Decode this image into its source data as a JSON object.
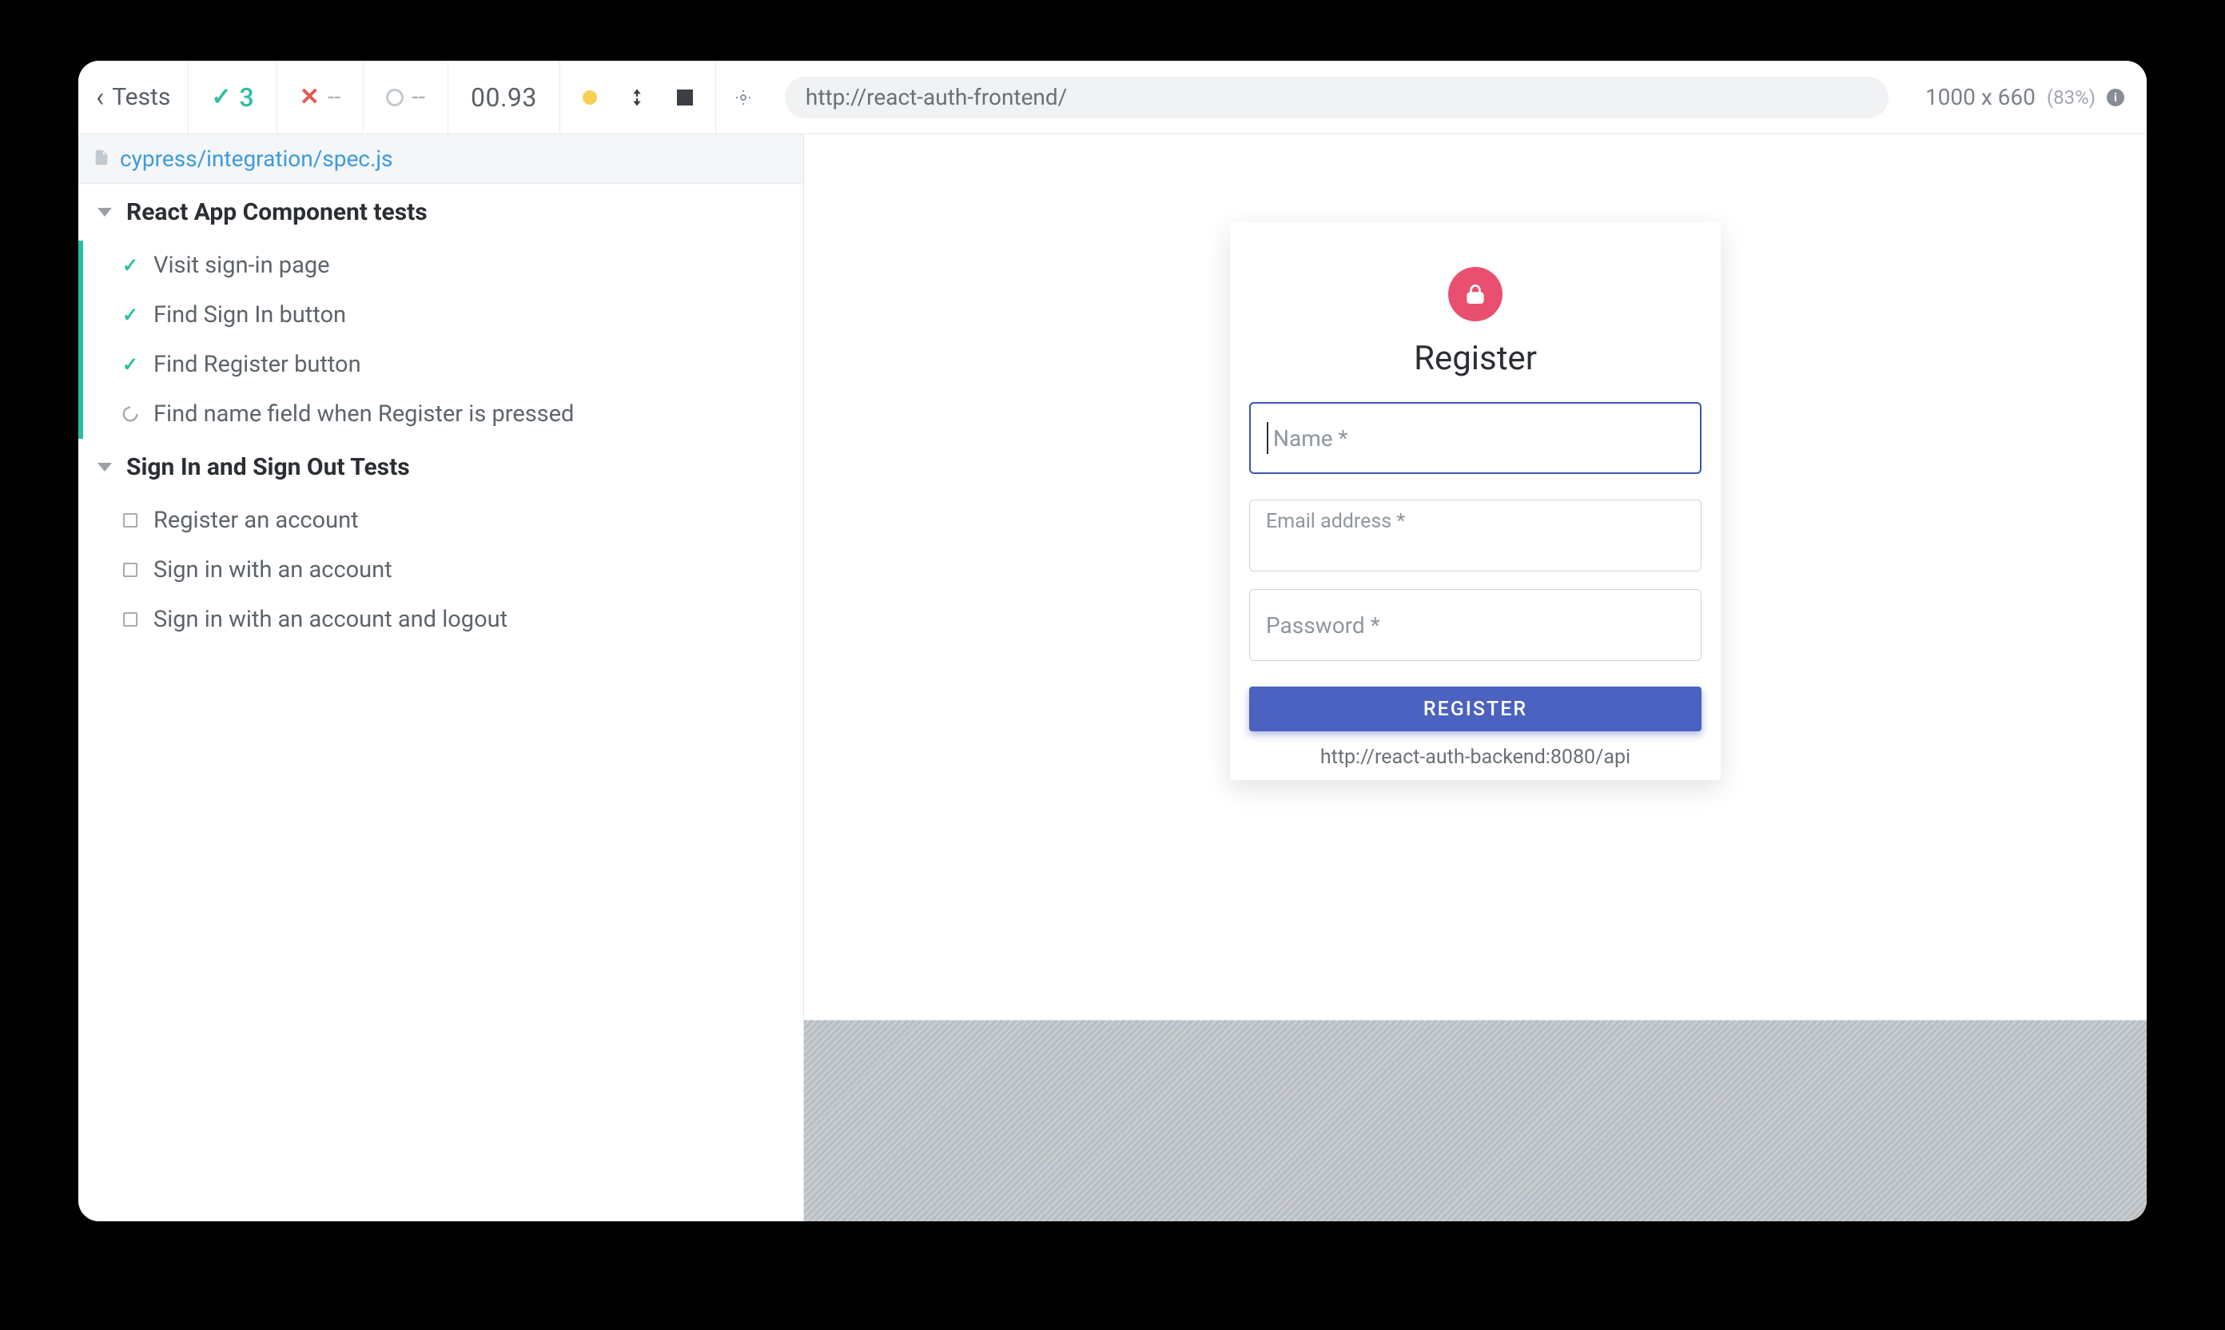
{
  "topbar": {
    "back_label": "Tests",
    "passes": "3",
    "failures": "--",
    "pending": "--",
    "timer": "00.93",
    "url": "http://react-auth-frontend/",
    "viewport": "1000 x 660",
    "scale": "(83%)"
  },
  "spec": {
    "path": "cypress/integration/spec.js"
  },
  "suites": [
    {
      "title": "React App Component tests",
      "active": true,
      "tests": [
        {
          "status": "passed",
          "title": "Visit sign-in page"
        },
        {
          "status": "passed",
          "title": "Find Sign In button"
        },
        {
          "status": "passed",
          "title": "Find Register button"
        },
        {
          "status": "running",
          "title": "Find name field when Register is pressed"
        }
      ]
    },
    {
      "title": "Sign In and Sign Out Tests",
      "active": false,
      "tests": [
        {
          "status": "pending",
          "title": "Register an account"
        },
        {
          "status": "pending",
          "title": "Sign in with an account"
        },
        {
          "status": "pending",
          "title": "Sign in with an account and logout"
        }
      ]
    }
  ],
  "app": {
    "card_title": "Register",
    "name_placeholder": "Name *",
    "email_label": "Email address *",
    "password_label": "Password *",
    "register_button": "REGISTER",
    "api_url": "http://react-auth-backend:8080/api"
  }
}
